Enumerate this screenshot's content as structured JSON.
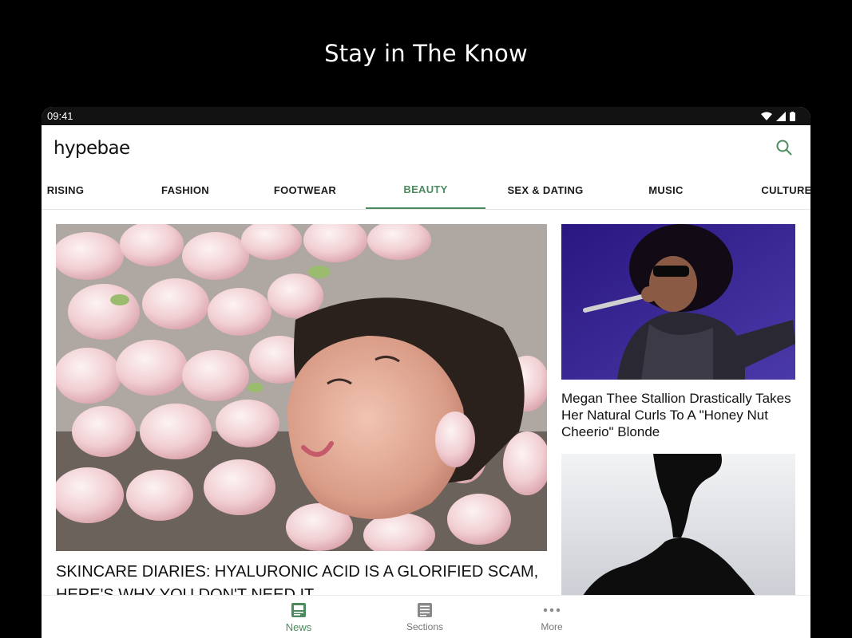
{
  "promo": {
    "title": "Stay in The Know"
  },
  "status_bar": {
    "time": "09:41"
  },
  "header": {
    "logo": "hypebae",
    "search_icon": "search-icon"
  },
  "tabs": [
    {
      "label": "RISING"
    },
    {
      "label": "FASHION"
    },
    {
      "label": "FOOTWEAR"
    },
    {
      "label": "BEAUTY",
      "active": true
    },
    {
      "label": "SEX & DATING"
    },
    {
      "label": "MUSIC"
    },
    {
      "label": "CULTURE"
    }
  ],
  "articles": {
    "hero": {
      "title": "SKINCARE DIARIES: HYALURONIC ACID IS A GLORIFIED SCAM, HERE'S WHY YOU DON'T NEED IT"
    },
    "side1": {
      "title": "Megan Thee Stallion Drastically Takes Her Natural Curls To A \"Honey Nut Cheerio\" Blonde"
    }
  },
  "bottom_nav": [
    {
      "label": "News",
      "icon": "news-icon",
      "active": true
    },
    {
      "label": "Sections",
      "icon": "sections-icon"
    },
    {
      "label": "More",
      "icon": "more-icon"
    }
  ],
  "colors": {
    "accent": "#4c8b5f",
    "status_bar": "#121212"
  }
}
